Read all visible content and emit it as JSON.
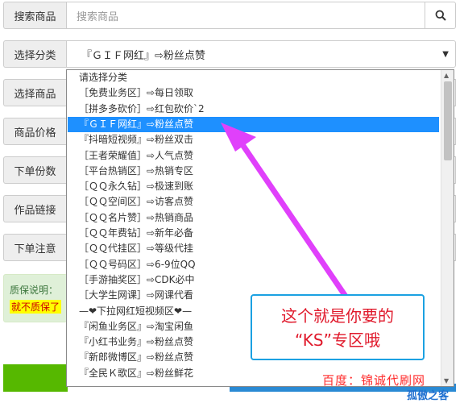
{
  "form": {
    "search": {
      "label": "搜索商品",
      "placeholder": "搜索商品"
    },
    "category": {
      "label": "选择分类",
      "value": "『ＧＩＦ网红』⇨粉丝点赞"
    },
    "product": {
      "label": "选择商品"
    },
    "price": {
      "label": "商品价格"
    },
    "quantity": {
      "label": "下单份数"
    },
    "link": {
      "label": "作品链接"
    },
    "notes": {
      "label": "下单注意"
    }
  },
  "notice": {
    "title": "质保说明：",
    "highlight": "就不质保了"
  },
  "dropdown": {
    "options": [
      "请选择分类",
      "［免费业务区］⇨每日领取",
      "［拼多多砍价］⇨红包砍价`2",
      "『ＧＩＦ网红』⇨粉丝点赞",
      "『抖暗短视频』⇨粉丝双击",
      "［王者荣耀值］⇨人气点赞",
      "［平台热销区］⇨热销专区",
      "［ＱＱ永久钻］⇨极速到账",
      "［ＱＱ空间区］⇨访客点赞",
      "［ＱＱ名片赞］⇨热销商品",
      "［ＱＱ年费钻］⇨新年必备",
      "［ＱＱ代挂区］⇨等级代挂",
      "［ＱＱ号码区］⇨6-9位QQ",
      "［手游抽奖区］⇨CDK必中",
      "［大学生网课］⇨网课代看",
      "—❤下拉网红短视频区❤—",
      "『闲鱼业务区』⇨淘宝闲鱼",
      "『小红书业务』⇨粉丝点赞",
      "『新郎微博区』⇨粉丝点赞",
      "『全民Ｋ歌区』⇨粉丝鲜花"
    ],
    "selected_index": 3
  },
  "callout": {
    "line1": "这个就是你要的",
    "line2": "“KS”专区哦"
  },
  "watermark": "百度：锦诚代刷网",
  "corner_logo": "孤傲之客",
  "colors": {
    "selected_bg": "#1e90ff",
    "arrow": "#e040fb",
    "callout_border": "#1ba1e2",
    "callout_text": "#e0192b",
    "notice_bg": "#dff0d8",
    "highlight_bg": "#ffff00"
  },
  "icons": {
    "search": "search-icon",
    "caret": "caret-down-icon"
  }
}
